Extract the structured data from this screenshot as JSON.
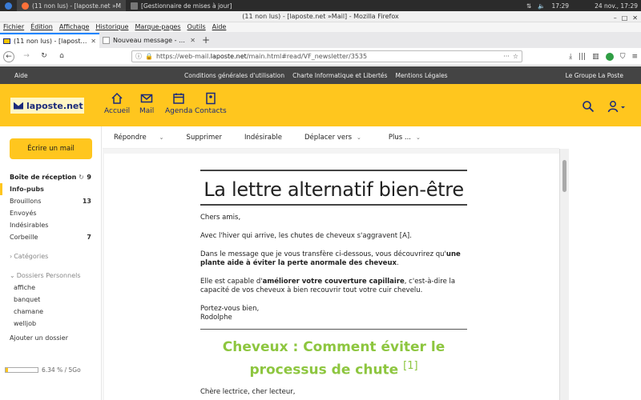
{
  "taskbar": {
    "items": [
      "(11 non lus) - [laposte.net »M",
      "[Gestionnaire de mises à jour]"
    ],
    "clock": "17:29",
    "date": "24 nov., 17:29"
  },
  "window": {
    "title": "(11 non lus) - [laposte.net »Mail] - Mozilla Firefox"
  },
  "menubar": [
    "Fichier",
    "Édition",
    "Affichage",
    "Historique",
    "Marque-pages",
    "Outils",
    "Aide"
  ],
  "tabs": [
    {
      "label": "(11 non lus) - [laposte.net »M"
    },
    {
      "label": "Nouveau message - CanalBle"
    }
  ],
  "nav": {
    "url_prefix": "https://web-mail.",
    "url_domain": "laposte.net",
    "url_suffix": "/main.html#read/VF_newsletter/3535"
  },
  "sitebar": {
    "aide": "Aide",
    "links": [
      "Conditions générales d'utilisation",
      "Charte Informatique et Libertés",
      "Mentions Légales"
    ],
    "groupe": "Le Groupe La Poste"
  },
  "header": {
    "logo": "laposte.net",
    "nav": [
      "Accueil",
      "Mail",
      "Agenda",
      "Contacts"
    ]
  },
  "sidebar": {
    "compose": "Écrire un mail",
    "folders": [
      {
        "label": "Boîte de réception",
        "count": "9"
      },
      {
        "label": "Info-pubs",
        "count": ""
      },
      {
        "label": "Brouillons",
        "count": "13"
      },
      {
        "label": "Envoyés",
        "count": ""
      },
      {
        "label": "Indésirables",
        "count": ""
      },
      {
        "label": "Corbeille",
        "count": "7"
      }
    ],
    "categories": "Catégories",
    "personal": "Dossiers Personnels",
    "subfolders": [
      "affiche",
      "banquet",
      "chamane",
      "welljob"
    ],
    "add_folder": "Ajouter un dossier",
    "quota": "6.34 % / 5Go",
    "quota_fraction": 0.0634
  },
  "toolbar": {
    "reply": "Répondre",
    "delete": "Supprimer",
    "spam": "Indésirable",
    "move": "Déplacer vers",
    "more": "Plus ..."
  },
  "email": {
    "title": "La lettre alternatif bien-être",
    "greeting": "Chers amis,",
    "p1": "Avec l'hiver qui arrive, les chutes de cheveux s'aggravent [A].",
    "p2a": "Dans le message que je vous transfère ci-dessous, vous découvrirez qu'",
    "p2b": "une plante aide à éviter la perte anormale des cheveux",
    "p2c": ".",
    "p3a": "Elle est capable d'",
    "p3b": "améliorer votre couverture capillaire",
    "p3c": ", c'est-à-dire la capacité de vos cheveux à bien recouvrir tout votre cuir chevelu.",
    "sign1": "Portez-vous bien,",
    "sign2": "Rodolphe",
    "headline": "Cheveux : Comment éviter le processus de chute",
    "headline_ref": "[1]",
    "next": "Chère lectrice, cher lecteur,"
  }
}
